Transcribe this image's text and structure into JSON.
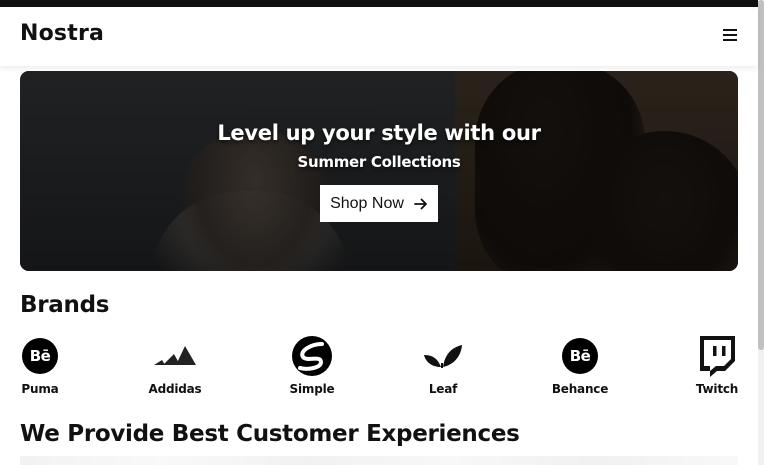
{
  "navbar": {
    "logo": "Nostra",
    "menu_icon": "hamburger-menu-icon"
  },
  "hero": {
    "title": "Level up your style with our",
    "subtitle": "Summer Collections",
    "cta_label": "Shop Now",
    "cta_icon": "arrow-right-icon"
  },
  "brands": {
    "title": "Brands",
    "items": [
      {
        "label": "Puma",
        "icon": "behance-icon"
      },
      {
        "label": "Addidas",
        "icon": "adidas-icon"
      },
      {
        "label": "Simple",
        "icon": "simple-icon"
      },
      {
        "label": "Leaf",
        "icon": "leaf-icon"
      },
      {
        "label": "Behance",
        "icon": "behance-icon"
      },
      {
        "label": "Twitch",
        "icon": "twitch-icon"
      }
    ]
  },
  "experience": {
    "title": "We Provide Best Customer Experiences"
  },
  "colors": {
    "text": "#111111",
    "background": "#ffffff",
    "button_bg": "#ffffff"
  }
}
